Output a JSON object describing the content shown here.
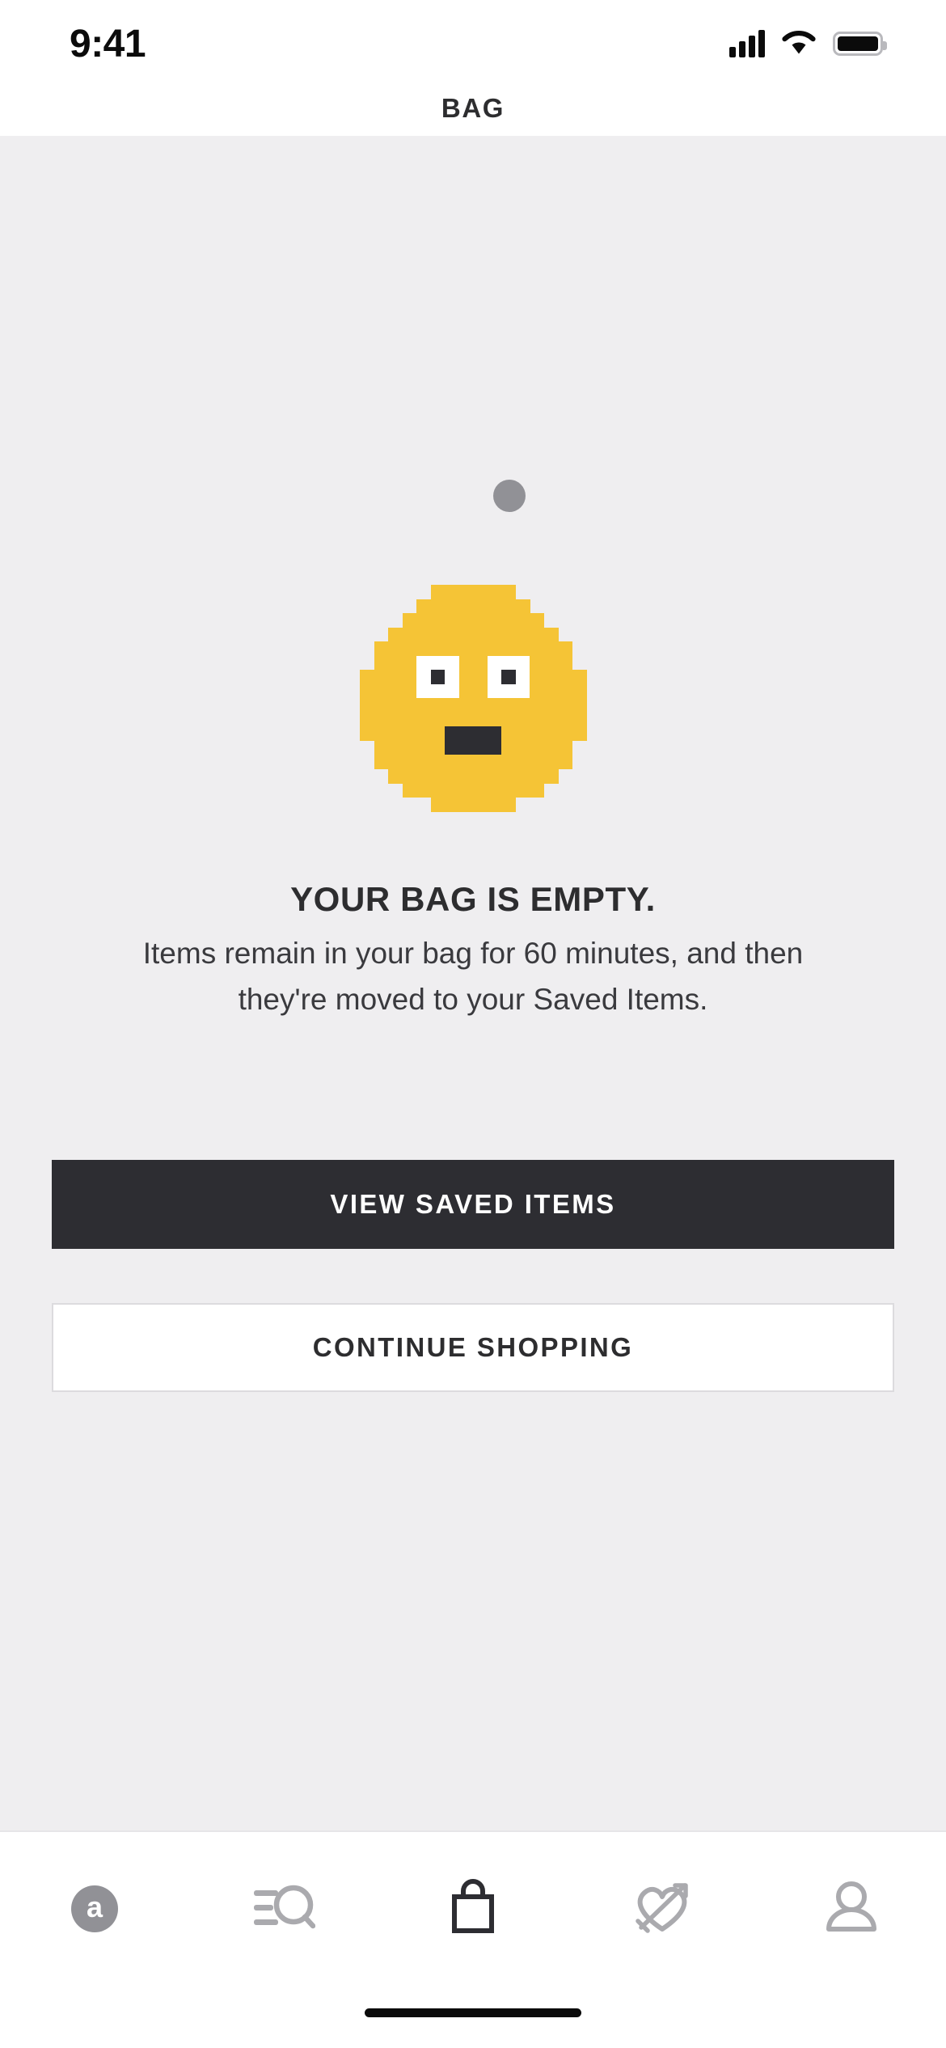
{
  "status_bar": {
    "time": "9:41",
    "cellular_icon": "cellular-signal-icon",
    "wifi_icon": "wifi-icon",
    "battery_icon": "battery-icon"
  },
  "header": {
    "title": "BAG"
  },
  "empty_state": {
    "illustration": "pixel-art-neutral-face-emoji",
    "headline": "YOUR BAG IS EMPTY.",
    "body": "Items remain in your bag for 60 minutes, and then they're moved to your Saved Items.",
    "primary_button": "VIEW SAVED ITEMS",
    "secondary_button": "CONTINUE SHOPPING"
  },
  "touch_indicator": {
    "visible": true
  },
  "tab_bar": {
    "items": [
      {
        "name": "home",
        "icon": "asos-logo-icon",
        "label": "a",
        "active": false
      },
      {
        "name": "search",
        "icon": "search-list-icon",
        "active": false
      },
      {
        "name": "bag",
        "icon": "shopping-bag-icon",
        "active": true
      },
      {
        "name": "saved",
        "icon": "heart-arrow-icon",
        "active": false
      },
      {
        "name": "account",
        "icon": "person-icon",
        "active": false
      }
    ]
  },
  "colors": {
    "background": "#efeef0",
    "surface": "#ffffff",
    "ink": "#2d2d2f",
    "primary_button_bg": "#2d2d32",
    "emoji_yellow": "#f5c436",
    "inactive_icon": "#aaaaae",
    "active_icon": "#2d2d32",
    "border": "#dcdbde"
  }
}
